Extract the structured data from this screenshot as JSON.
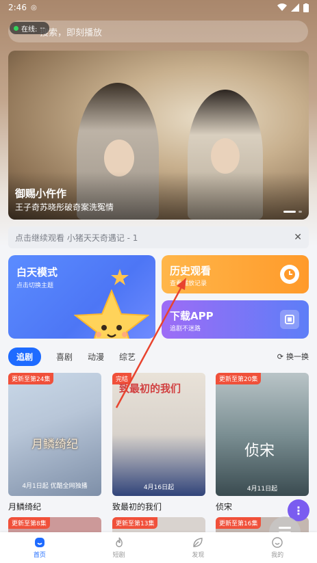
{
  "status_bar": {
    "time": "2:46"
  },
  "search": {
    "placeholder": "搜索，即刻播放",
    "online_label": "在线:",
    "online_value": "--"
  },
  "banner": {
    "title": "御赐小仵作",
    "subtitle": "王子奇苏晓彤破奇案洗冤情"
  },
  "continue_watching": {
    "text": "点击继续观看 小猪天天奇遇记 - 1"
  },
  "cards": {
    "day_mode": {
      "title": "白天模式",
      "subtitle": "点击切换主题"
    },
    "history": {
      "title": "历史观看",
      "subtitle": "查看播放记录"
    },
    "download": {
      "title": "下载APP",
      "subtitle": "追剧不迷路"
    }
  },
  "tabs": [
    {
      "label": "追剧",
      "active": true
    },
    {
      "label": "喜剧",
      "active": false
    },
    {
      "label": "动漫",
      "active": false
    },
    {
      "label": "综艺",
      "active": false
    }
  ],
  "refresh_label": "换一换",
  "posters": [
    {
      "badge": "更新至第24集",
      "name": "月鳞绮纪",
      "poster_text": "月鳞绮纪",
      "poster_caption": "4月1日起 优酷全网独播"
    },
    {
      "badge": "完结",
      "name": "致最初的我们",
      "poster_text": "致最初的我们",
      "poster_caption": "4月16日起"
    },
    {
      "badge": "更新至第20集",
      "name": "侦宋",
      "poster_text": "侦宋",
      "poster_caption": "4月11日起"
    }
  ],
  "posters_row2": [
    {
      "badge": "更新至第8集"
    },
    {
      "badge": "更新至第13集"
    },
    {
      "badge": "更新至第16集"
    }
  ],
  "bottom_nav": [
    {
      "label": "首页",
      "icon": "home-icon",
      "active": true
    },
    {
      "label": "短剧",
      "icon": "fire-icon",
      "active": false
    },
    {
      "label": "发现",
      "icon": "leaf-icon",
      "active": false
    },
    {
      "label": "我的",
      "icon": "smile-icon",
      "active": false
    }
  ],
  "colors": {
    "accent": "#1e6bff",
    "badge": "#f0503a",
    "history": "#ff9a2a",
    "download": "#7a6cf6",
    "arrow": "#e8432e"
  }
}
